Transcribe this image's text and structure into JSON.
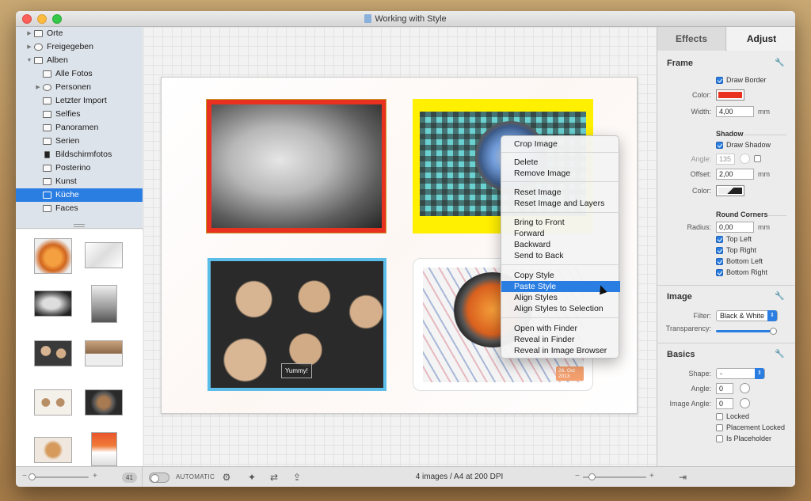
{
  "window": {
    "title": "Working with Style"
  },
  "sidebar": {
    "items": [
      {
        "label": "Orte"
      },
      {
        "label": "Freigegeben"
      },
      {
        "label": "Alben"
      },
      {
        "label": "Alle Fotos"
      },
      {
        "label": "Personen"
      },
      {
        "label": "Letzter Import"
      },
      {
        "label": "Selfies"
      },
      {
        "label": "Panoramen"
      },
      {
        "label": "Serien"
      },
      {
        "label": "Bildschirmfotos"
      },
      {
        "label": "Posterino"
      },
      {
        "label": "Kunst"
      },
      {
        "label": "Küche",
        "selected": true
      },
      {
        "label": "Faces"
      }
    ],
    "photo_count": "41",
    "slider_value": 0.0
  },
  "canvas": {
    "captions": {
      "yummy": "Yummy!",
      "date": "26. Oct 2013"
    }
  },
  "context_menu": {
    "groups": [
      [
        "Crop Image"
      ],
      [
        "Delete",
        "Remove Image"
      ],
      [
        "Reset Image",
        "Reset Image and Layers"
      ],
      [
        "Bring to Front",
        "Forward",
        "Backward",
        "Send to Back"
      ],
      [
        "Copy Style",
        "Paste Style",
        "Align Styles",
        "Align Styles to Selection"
      ],
      [
        "Open with Finder",
        "Reveal in Finder",
        "Reveal in Image Browser"
      ]
    ],
    "highlighted": "Paste Style"
  },
  "bottom_bar": {
    "automatic_label": "AUTOMATIC",
    "status": "4 images / A4 at 200 DPI",
    "zoom_value": 0.1
  },
  "inspector": {
    "tabs": {
      "effects": "Effects",
      "adjust": "Adjust"
    },
    "frame": {
      "title": "Frame",
      "draw_border": "Draw Border",
      "color_label": "Color:",
      "border_color": "#e8311f",
      "width_label": "Width:",
      "width_value": "4,00",
      "unit": "mm",
      "shadow_title": "Shadow",
      "draw_shadow": "Draw Shadow",
      "angle_label": "Angle:",
      "angle_value": "135",
      "offset_label": "Offset:",
      "offset_value": "2,00",
      "shadow_color_label": "Color:",
      "round_corners_title": "Round Corners",
      "radius_label": "Radius:",
      "radius_value": "0,00",
      "top_left": "Top Left",
      "top_right": "Top Right",
      "bottom_left": "Bottom Left",
      "bottom_right": "Bottom Right"
    },
    "image": {
      "title": "Image",
      "filter_label": "Filter:",
      "filter_value": "Black & White",
      "transparency_label": "Transparency:",
      "transparency_value": 1.0
    },
    "basics": {
      "title": "Basics",
      "shape_label": "Shape:",
      "shape_value": "-",
      "angle_label": "Angle:",
      "angle_value": "0",
      "image_angle_label": "Image Angle:",
      "image_angle_value": "0",
      "locked": "Locked",
      "placement_locked": "Placement Locked",
      "is_placeholder": "Is Placeholder"
    }
  },
  "colors": {
    "accent": "#2a7de1"
  }
}
